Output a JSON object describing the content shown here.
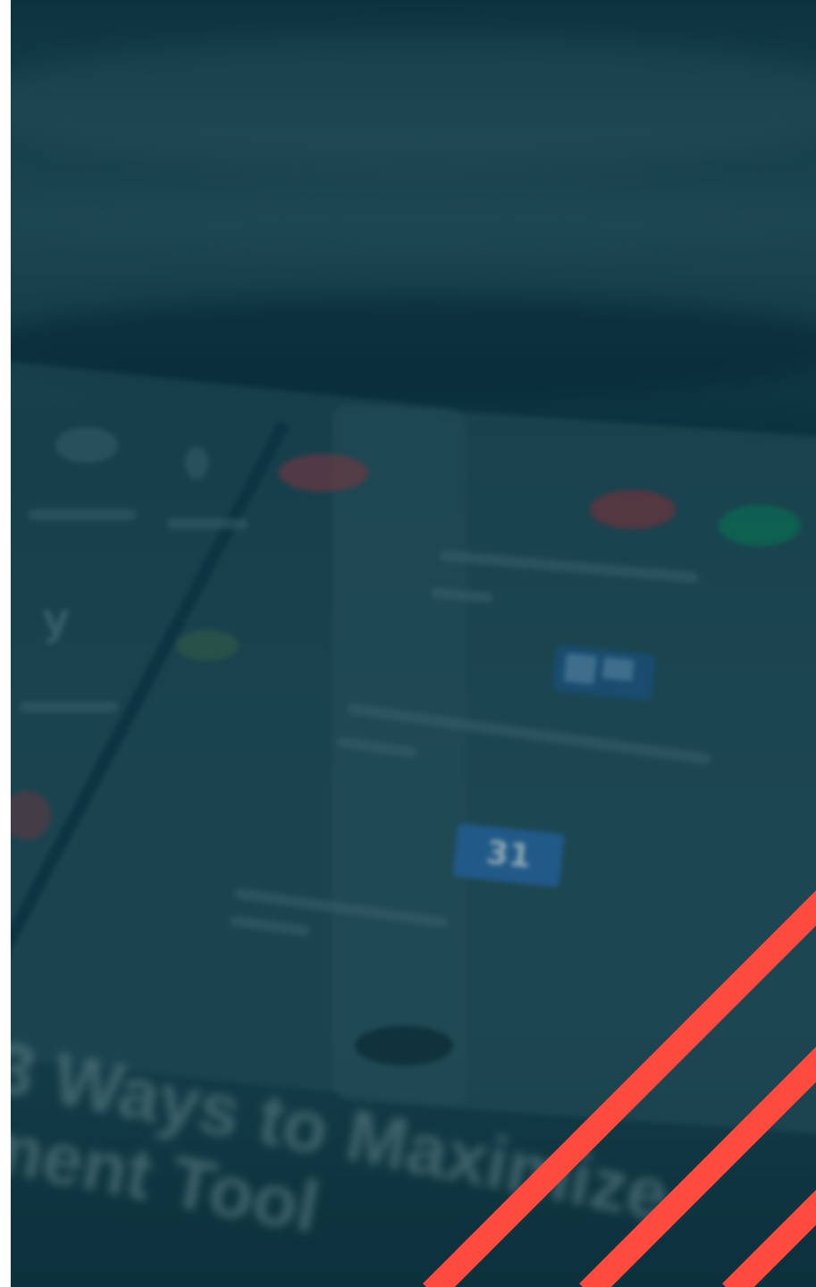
{
  "image": {
    "headline_line_1": "3 Ways to Maximize",
    "headline_line_2": "ment Tool",
    "calendar_day": "31",
    "colors": {
      "overlay": "#0f3a47",
      "stripe": "#ff4a3f",
      "icon_red": "#b8323a",
      "icon_green": "#0e8a5f",
      "icon_blue": "#2e6fb1"
    }
  }
}
